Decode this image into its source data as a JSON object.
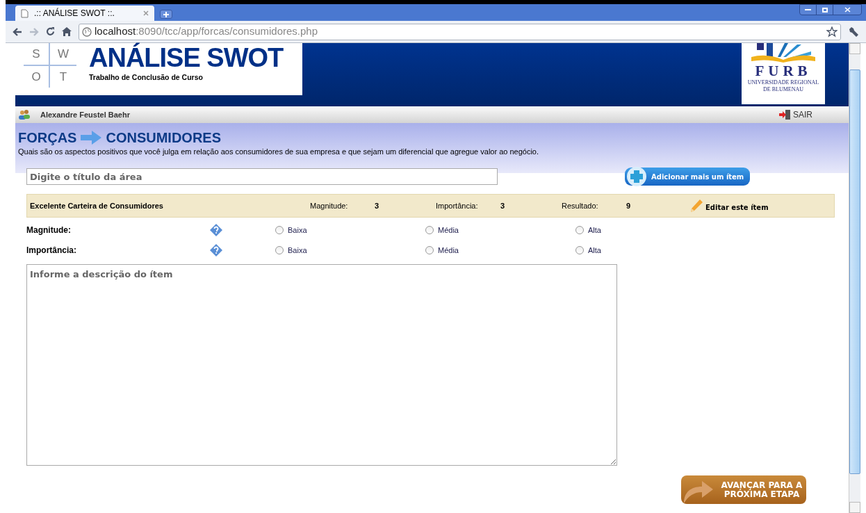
{
  "browser": {
    "tab_title": ".:: ANÁLISE SWOT ::.",
    "url_host": "localhost",
    "url_path": ":8090/tcc/app/forcas/consumidores.php"
  },
  "header": {
    "logo_letters": [
      "S",
      "W",
      "O",
      "T"
    ],
    "title": "ANÁLISE SWOT",
    "subtitle": "Trabalho de Conclusão de Curso",
    "partner_name": "FURB",
    "partner_lines": [
      "UNIVERSIDADE REGIONAL",
      "DE BLUMENAU"
    ]
  },
  "user_bar": {
    "user": "Alexandre Feustel Baehr",
    "logout": "SAIR"
  },
  "heading": {
    "section": "FORÇAS",
    "topic": "CONSUMIDORES",
    "description": "Quais são os aspectos positivos que você julga em relação aos consumidores de sua empresa e que sejam um diferencial que agregue valor ao negócio."
  },
  "title_field": {
    "placeholder": "Digite o título da área"
  },
  "add_button": "Adicionar mais um ítem",
  "item": {
    "title": "Excelente Carteira de Consumidores",
    "fields": [
      {
        "label": "Magnitude:",
        "value": "3"
      },
      {
        "label": "Importância:",
        "value": "3"
      },
      {
        "label": "Resultado:",
        "value": "9"
      }
    ],
    "edit": "Editar este ítem"
  },
  "ratings": [
    {
      "label": "Magnitude:",
      "options": [
        {
          "label": "Baixa",
          "selected": false
        },
        {
          "label": "Média",
          "selected": false
        },
        {
          "label": "Alta",
          "selected": false
        }
      ]
    },
    {
      "label": "Importância:",
      "options": [
        {
          "label": "Baixa",
          "selected": false
        },
        {
          "label": "Média",
          "selected": false
        },
        {
          "label": "Alta",
          "selected": false
        }
      ]
    }
  ],
  "description_field": {
    "placeholder": "Informe a descrição do ítem"
  },
  "next_button": [
    "AVANÇAR PARA A",
    "PRÓXIMA ETAPA"
  ]
}
